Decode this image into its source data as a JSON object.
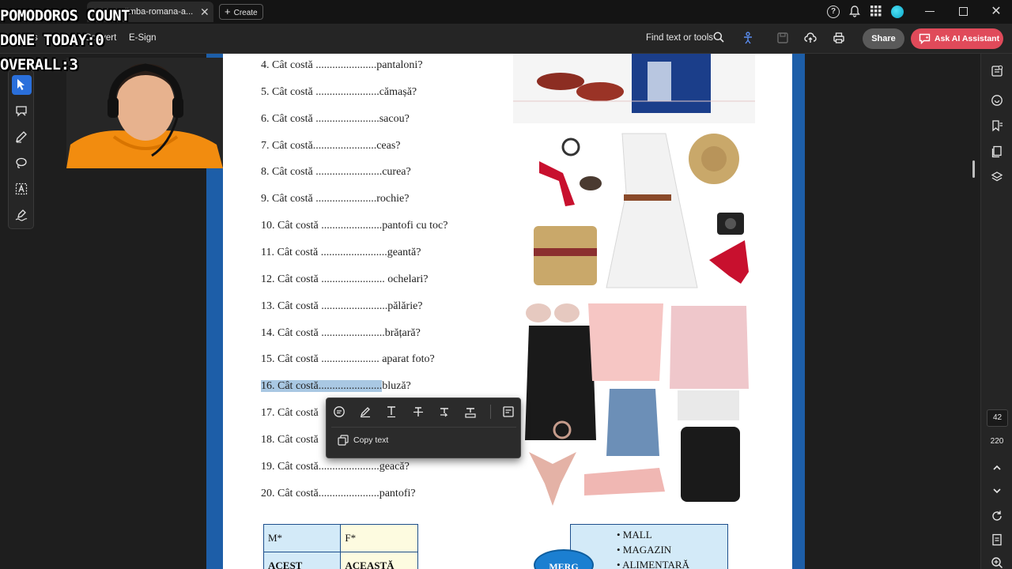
{
  "overlay": {
    "line1": "POMODOROS COUNT",
    "line2": "DONE TODAY:0",
    "line3": "OVERALL:3"
  },
  "titlebar": {
    "tab_title": "limba-romana-a...",
    "create_label": "Create"
  },
  "toolbar": {
    "menu_partial": "s",
    "convert": "Convert",
    "esign": "E-Sign",
    "find_tools": "Find text or tools",
    "share": "Share",
    "ask_ai": "Ask AI Assistant"
  },
  "document": {
    "questions": [
      {
        "prefix": "4. Cât costă ......................",
        "suffix": "pantaloni?"
      },
      {
        "prefix": "5. Cât costă .......................",
        "suffix": "cămașă?"
      },
      {
        "prefix": "6. Cât costă .......................",
        "suffix": "sacou?"
      },
      {
        "prefix": "7. Cât costă.......................",
        "suffix": "ceas?"
      },
      {
        "prefix": "8. Cât costă ........................",
        "suffix": "curea?"
      },
      {
        "prefix": "9. Cât costă ......................",
        "suffix": "rochie?"
      },
      {
        "prefix": "10. Cât costă ......................",
        "suffix": "pantofi cu toc?"
      },
      {
        "prefix": "11. Cât costă ........................",
        "suffix": "geantă?"
      },
      {
        "prefix": "12. Cât costă ....................... ",
        "suffix": "ochelari?"
      },
      {
        "prefix": "13. Cât costă ........................",
        "suffix": "pălărie?"
      },
      {
        "prefix": "14. Cât costă .......................",
        "suffix": "brățară?"
      },
      {
        "prefix": "15. Cât costă ..................... ",
        "suffix": "aparat foto?"
      },
      {
        "prefix": "16. Cât costă.......................",
        "suffix": "bluză?"
      },
      {
        "prefix": "17. Cât costă",
        "suffix": ""
      },
      {
        "prefix": "18. Cât costă",
        "suffix": ""
      },
      {
        "prefix": "19. Cât costă......................",
        "suffix": "geacă?"
      },
      {
        "prefix": "20. Cât costă......................",
        "suffix": "pantofi?"
      }
    ],
    "table": {
      "m_header": "M*",
      "f_header": "F*",
      "m_value": "ACEST",
      "f_value": "ACEASTĂ"
    },
    "places": [
      "• MALL",
      "• MAGAZIN",
      "• ALIMENTARĂ"
    ],
    "merg": "MERG"
  },
  "popup": {
    "copy_text": "Copy text"
  },
  "right_rail": {
    "page_number": "42",
    "page_total": "220"
  }
}
